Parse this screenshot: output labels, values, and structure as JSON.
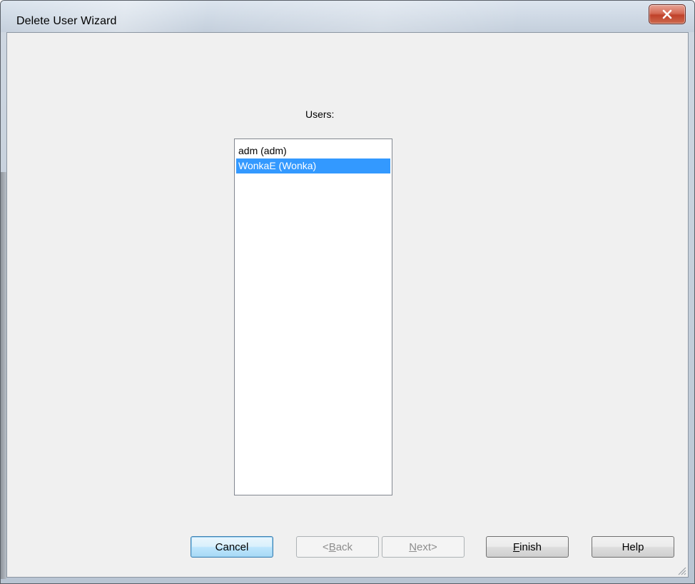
{
  "window": {
    "title": "Delete User Wizard",
    "close_icon": "close-icon"
  },
  "main": {
    "users_label": "Users:",
    "users": [
      {
        "label": "adm (adm)",
        "selected": false
      },
      {
        "label": "WonkaE (Wonka)",
        "selected": true
      }
    ]
  },
  "buttons": {
    "cancel": {
      "label": "Cancel",
      "enabled": true,
      "default": true
    },
    "back": {
      "prefix": "<",
      "mnemonic": "B",
      "rest": "ack",
      "enabled": false
    },
    "next": {
      "mnemonic": "N",
      "rest": "ext>",
      "enabled": false
    },
    "finish": {
      "mnemonic": "F",
      "rest": "inish",
      "enabled": true
    },
    "help": {
      "label": "Help",
      "enabled": true
    }
  },
  "colors": {
    "selection": "#3399ff",
    "close_button": "#c0412a"
  }
}
